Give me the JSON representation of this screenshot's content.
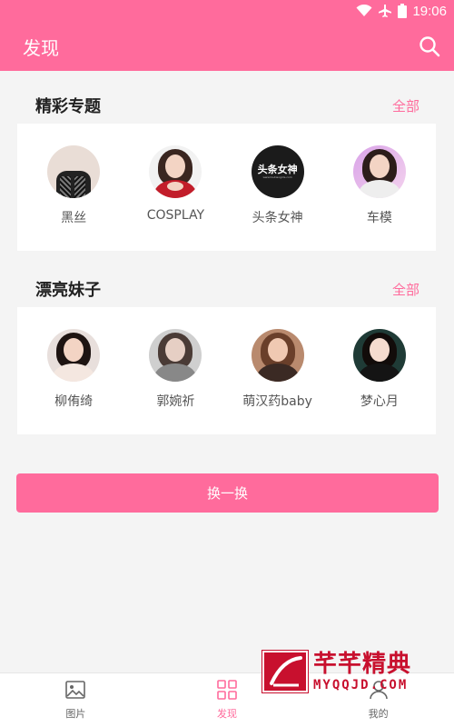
{
  "status_bar": {
    "time": "19:06",
    "icons": [
      "wifi-icon",
      "airplane-icon",
      "battery-icon"
    ]
  },
  "app_bar": {
    "title": "发现",
    "search_icon": "search-icon"
  },
  "sections": [
    {
      "title": "精彩专题",
      "more_label": "全部",
      "items": [
        {
          "label": "黑丝"
        },
        {
          "label": "COSPLAY"
        },
        {
          "label": "头条女神",
          "logo_text": "头条女神",
          "logo_url": "www.toutiaogirls.com"
        },
        {
          "label": "车模"
        }
      ]
    },
    {
      "title": "漂亮妹子",
      "more_label": "全部",
      "items": [
        {
          "label": "柳侑绮"
        },
        {
          "label": "郭婉祈"
        },
        {
          "label": "萌汉药baby"
        },
        {
          "label": "梦心月"
        }
      ]
    }
  ],
  "shuffle_button": {
    "label": "换一换"
  },
  "bottom_nav": {
    "items": [
      {
        "label": "图片",
        "icon": "image-icon",
        "active": false
      },
      {
        "label": "发现",
        "icon": "grid-icon",
        "active": true
      },
      {
        "label": "我的",
        "icon": "user-icon",
        "active": false
      }
    ]
  },
  "watermark": {
    "text_cn": "芊芊精典",
    "text_en": "MYQQJD.COM"
  },
  "colors": {
    "accent": "#ff6b9c",
    "background": "#f4f4f4",
    "card": "#ffffff",
    "watermark": "#c8102e"
  }
}
